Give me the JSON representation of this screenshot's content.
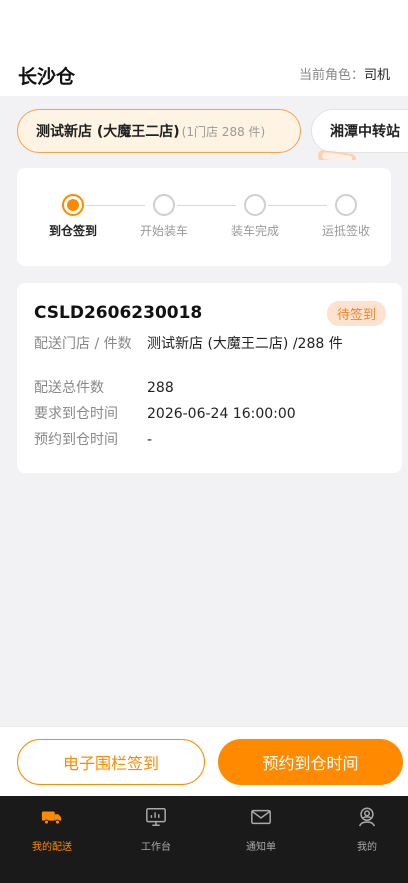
{
  "header": {
    "warehouse": "长沙仓",
    "role_prefix": "当前角色：",
    "role_value": "司机"
  },
  "store_chips": [
    {
      "name": "测试新店 (大魔王二店)",
      "sub": "(1门店 288 件)"
    },
    {
      "name": "湘潭中转站"
    }
  ],
  "steps": [
    {
      "label": "到仓签到",
      "state": "current"
    },
    {
      "label": "开始装车",
      "state": "pending"
    },
    {
      "label": "装车完成",
      "state": "pending"
    },
    {
      "label": "运抵签收",
      "state": "pending"
    }
  ],
  "order": {
    "number": "CSLD2606230018",
    "status": "待签到",
    "rows": [
      {
        "key": "配送门店 / 件数",
        "value": "测试新店 (大魔王二店) /288 件"
      },
      {
        "key": "配送总件数",
        "value": "288"
      },
      {
        "key": "要求到仓时间",
        "value": "2026-06-24 16:00:00"
      },
      {
        "key": "预约到仓时间",
        "value": "-"
      }
    ]
  },
  "actions": {
    "fence_checkin": "电子围栏签到",
    "book_time": "预约到仓时间"
  },
  "tabbar": [
    {
      "label": "我的配送",
      "icon": "truck-icon",
      "active": true
    },
    {
      "label": "工作台",
      "icon": "dashboard-icon",
      "active": false
    },
    {
      "label": "通知单",
      "icon": "mail-icon",
      "active": false
    },
    {
      "label": "我的",
      "icon": "user-icon",
      "active": false
    }
  ],
  "colors": {
    "accent": "#ff8a00",
    "badge_bg": "#fde3cf",
    "tabbar_bg": "#1a1a1a"
  }
}
